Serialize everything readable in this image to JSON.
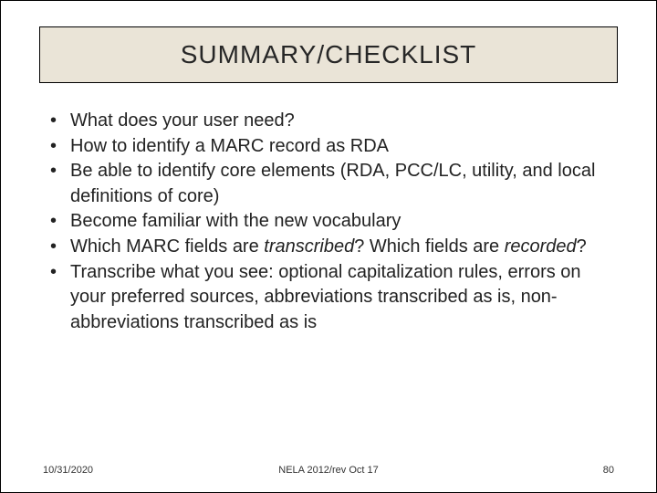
{
  "title": "SUMMARY/CHECKLIST",
  "bullets": [
    {
      "pre": "What does your user need?",
      "ital": "",
      "post": ""
    },
    {
      "pre": "How to identify a MARC record as RDA",
      "ital": "",
      "post": ""
    },
    {
      "pre": "Be able to identify core elements (RDA, PCC/LC, utility, and local definitions of core)",
      "ital": "",
      "post": ""
    },
    {
      "pre": "Become familiar with the new vocabulary",
      "ital": "",
      "post": ""
    },
    {
      "pre": "Which MARC fields are ",
      "ital": "transcribed",
      "post": "? Which fields are ",
      "ital2": "recorded",
      "post2": "?"
    },
    {
      "pre": "Transcribe what you see: optional capitalization rules, errors on your preferred sources, abbreviations transcribed as is, non-abbreviations transcribed as is",
      "ital": "",
      "post": ""
    }
  ],
  "footer": {
    "left": "10/31/2020",
    "center": "NELA 2012/rev Oct 17",
    "right": "80"
  }
}
